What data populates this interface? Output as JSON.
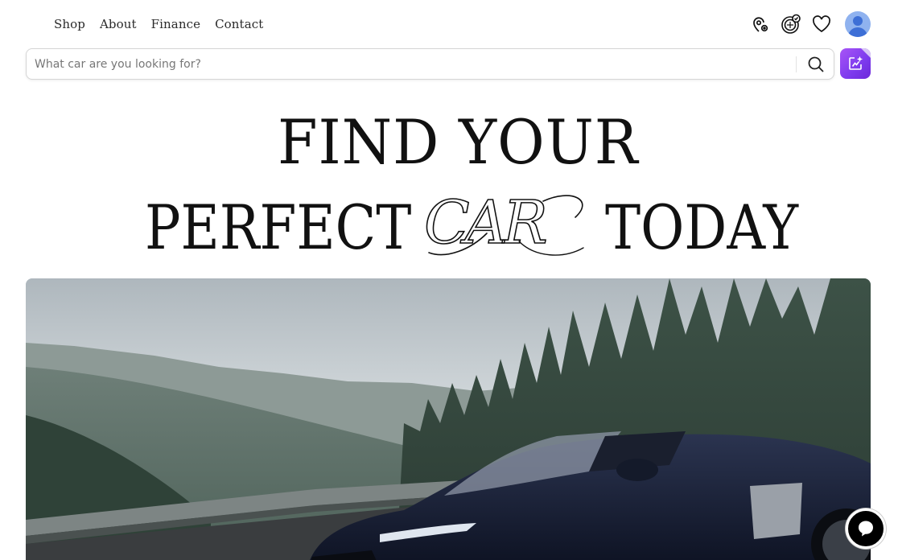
{
  "nav": {
    "items": [
      {
        "label": "Shop"
      },
      {
        "label": "About"
      },
      {
        "label": "Finance"
      },
      {
        "label": "Contact"
      }
    ]
  },
  "header_icons": [
    "location-pin-icon",
    "dealer-badge-icon",
    "heart-icon",
    "user-avatar"
  ],
  "search": {
    "placeholder": "What car are you looking for?",
    "value": ""
  },
  "hero": {
    "line1": "FIND YOUR",
    "line2_left": "PERFECT",
    "line2_script": "CAR",
    "line2_right": "TODAY",
    "media": "convertible sports car on mountain road"
  },
  "colors": {
    "accent": "#7c3aed",
    "avatar": "#8fb2ef",
    "text": "#111111"
  }
}
